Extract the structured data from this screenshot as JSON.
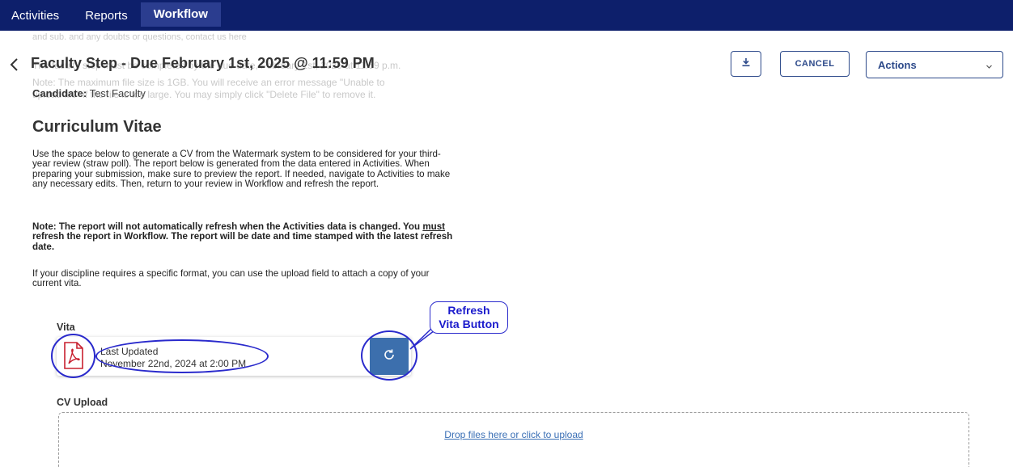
{
  "nav": {
    "tabs": [
      {
        "label": "Activities"
      },
      {
        "label": "Reports"
      },
      {
        "label": "Workflow"
      }
    ]
  },
  "ghost": {
    "line1": "and sub. and any doubts or questions, contact us here",
    "line2": "The faculty step must be completed by the due date, February 1st, 2025 at 11:59 p.m.",
    "line3": "Note: The maximum file size is 1GB. You will receive an error message \"Unable to",
    "line4": "upload file\" if the file is too large. You may simply click \"Delete File\" to remove it."
  },
  "header": {
    "title": "Faculty Step - Due February 1st, 2025 @ 11:59 PM",
    "candidate_label": "Candidate:",
    "candidate_value": "Test Faculty",
    "cancel_label": "CANCEL",
    "actions_label": "Actions"
  },
  "content": {
    "section_title": "Curriculum Vitae",
    "p1": "Use the space below to generate a CV from the Watermark system to be considered for your third-year review (straw poll). The report below is generated from the data entered in Activities. When preparing your submission, make sure to preview the report. If needed, navigate to Activities to make any necessary edits. Then, return to your review in Workflow and refresh the report.",
    "p2_a": "Note: The report will not automatically refresh when the Activities data is changed. You ",
    "p2_must": "must",
    "p2_b": " refresh the report in Workflow. The report will be date and time stamped with the latest refresh date.",
    "p3": "If your discipline requires a specific format, you can use the upload field to attach a copy of your current vita."
  },
  "vita": {
    "label": "Vita",
    "updated_label": "Last Updated",
    "updated_date": "November 22nd, 2024 at 2:00 PM"
  },
  "upload": {
    "label": "CV Upload",
    "drop_text": "Drop files here or click to upload"
  },
  "annotation": {
    "callout_line1": "Refresh",
    "callout_line2": "Vita Button",
    "color": "#2a2acc"
  },
  "colors": {
    "nav_bg": "#0d1f6b",
    "accent": "#2d4a8a",
    "refresh_button": "#3c6fad",
    "pdf_red": "#c8202f"
  }
}
